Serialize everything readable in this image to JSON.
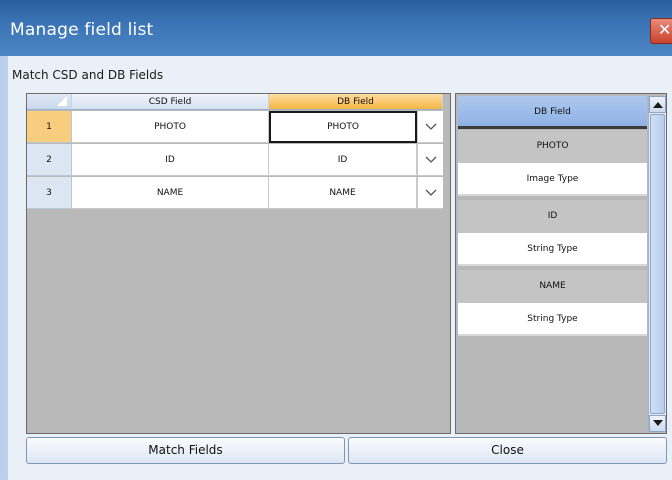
{
  "window": {
    "title": "Manage field list",
    "close_glyph": "✕"
  },
  "group_label": "Match CSD and DB Fields",
  "grid": {
    "headers": {
      "csd": "CSD Field",
      "db": "DB Field"
    },
    "rows": [
      {
        "num": "1",
        "csd": "PHOTO",
        "db": "PHOTO"
      },
      {
        "num": "2",
        "csd": "ID",
        "db": "ID"
      },
      {
        "num": "3",
        "csd": "NAME",
        "db": "NAME"
      }
    ]
  },
  "db_list": {
    "header": "DB Field",
    "items": [
      {
        "name": "PHOTO",
        "type": "Image Type"
      },
      {
        "name": "ID",
        "type": "String Type"
      },
      {
        "name": "NAME",
        "type": "String Type"
      }
    ]
  },
  "buttons": {
    "match": "Match Fields",
    "close": "Close"
  },
  "colors": {
    "titlebar": "#3a73b4",
    "active_header": "#f5b545",
    "selected_row": "#f9cd7e",
    "list_header": "#8fb2e6"
  }
}
